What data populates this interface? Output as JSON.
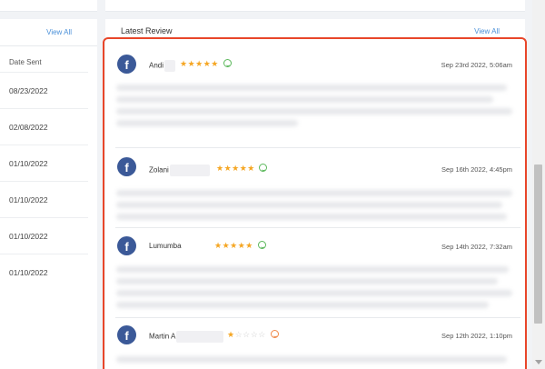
{
  "left_panel": {
    "view_all": "View All",
    "date_header": "Date Sent",
    "dates": [
      "08/23/2022",
      "02/08/2022",
      "01/10/2022",
      "01/10/2022",
      "01/10/2022",
      "01/10/2022"
    ]
  },
  "review_panel": {
    "title": "Latest Review",
    "view_all": "View All",
    "reviews": [
      {
        "source_icon": "facebook-icon",
        "name": "Andi",
        "rating": 5,
        "sentiment": "positive",
        "date": "Sep 23rd 2022, 5:06am"
      },
      {
        "source_icon": "facebook-icon",
        "name": "Zolani",
        "rating": 5,
        "sentiment": "positive",
        "date": "Sep 16th 2022, 4:45pm"
      },
      {
        "source_icon": "facebook-icon",
        "name": "Lumumba",
        "rating": 5,
        "sentiment": "positive",
        "date": "Sep 14th 2022, 7:32am"
      },
      {
        "source_icon": "facebook-icon",
        "name": "Martin A",
        "rating": 1,
        "sentiment": "negative",
        "date": "Sep 12th 2022, 1:10pm"
      }
    ]
  },
  "colors": {
    "accent_link": "#4a90d9",
    "facebook": "#3b5998",
    "star": "#f5a623",
    "highlight_border": "#e8462a",
    "positive": "#5cb85c",
    "negative": "#f08a4b"
  }
}
